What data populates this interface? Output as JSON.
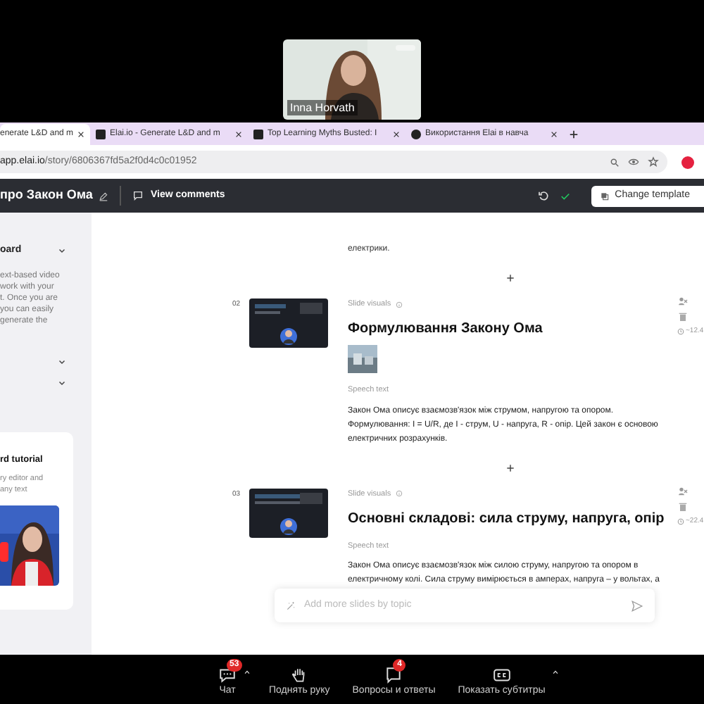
{
  "video_tile": {
    "participant": "Inna Horvath",
    "kind": "picture"
  },
  "browser": {
    "tabs": [
      {
        "label": "enerate L&D and m",
        "selected": true
      },
      {
        "label": "Elai.io - Generate L&D and m",
        "selected": false,
        "kind": "square"
      },
      {
        "label": "Top Learning Myths Busted: I",
        "selected": false,
        "kind": "square"
      },
      {
        "label": "Використання Elai в навча",
        "selected": false,
        "kind": "round"
      }
    ],
    "url_host": "app.elai.io",
    "url_path": "/story/6806367fd5a2f0d4c0c01952"
  },
  "app_header": {
    "title": "про Закон Ома",
    "comments": "View comments",
    "change_template": "Change template"
  },
  "sidebar": {
    "section_title": "oard",
    "description": [
      "ext-based video",
      "work with your",
      "t. Once you are",
      "you can easily",
      "generate the"
    ],
    "tutorial": {
      "title": "rd tutorial",
      "description": [
        "ry editor and",
        "any text"
      ],
      "kind": "picture"
    }
  },
  "intro_tail": "електрики.",
  "slides": [
    {
      "number": "02",
      "visuals_label": "Slide visuals",
      "title": "Формулювання Закону Ома",
      "image": {
        "kind": "picture"
      },
      "speech_label": "Speech text",
      "speech": [
        "Закон Ома описує взаємозв'язок між струмом, напругою та опором.",
        "Формулювання: I = U/R, де I - струм, U - напруга, R - опір. Цей закон є основою",
        "електричних розрахунків."
      ],
      "duration": "~12.4"
    },
    {
      "number": "03",
      "visuals_label": "Slide visuals",
      "title": "Основні складові: сила струму, напруга, опір",
      "speech_label": "Speech text",
      "speech": [
        "Закон Ома описує взаємозв'язок між силою струму, напругою та опором в",
        "електричному колі. Сила струму вимірюється в амперах, напруга – у вольтах, а"
      ],
      "duration": "~22.4"
    }
  ],
  "prompt": {
    "placeholder": "Add more slides by topic"
  },
  "meeting_bar": [
    {
      "kind": "chat",
      "label": "Чат",
      "badge": "53",
      "caret": true
    },
    {
      "kind": "hand",
      "label": "Поднять руку",
      "caret": false
    },
    {
      "kind": "qa",
      "label": "Вопросы и ответы",
      "badge": "4",
      "caret": false
    },
    {
      "kind": "cc",
      "label": "Показать субтитры",
      "caret": true
    }
  ]
}
